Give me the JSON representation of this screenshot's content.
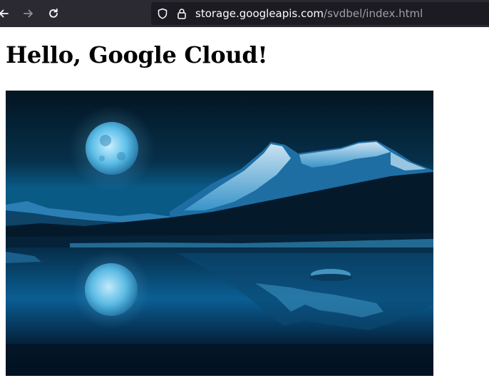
{
  "browser": {
    "url": {
      "host": "storage.googleapis.com",
      "path": "/svdbel/index.html"
    },
    "icons": {
      "back": "arrow-left-icon",
      "forward": "arrow-right-icon",
      "reload": "reload-icon",
      "tracking_protection": "shield-icon",
      "secure": "lock-icon"
    }
  },
  "page": {
    "heading": "Hello, Google Cloud!",
    "image": {
      "subject": "moonlit-mountain-lake-photo"
    }
  },
  "colors": {
    "toolbar": "#2b2a33",
    "urlbar": "#1c1b22",
    "url_host": "#fbfbfe",
    "url_path": "#9e9ea6",
    "night_sky": "#062335",
    "moon": "#4fb0e0"
  }
}
